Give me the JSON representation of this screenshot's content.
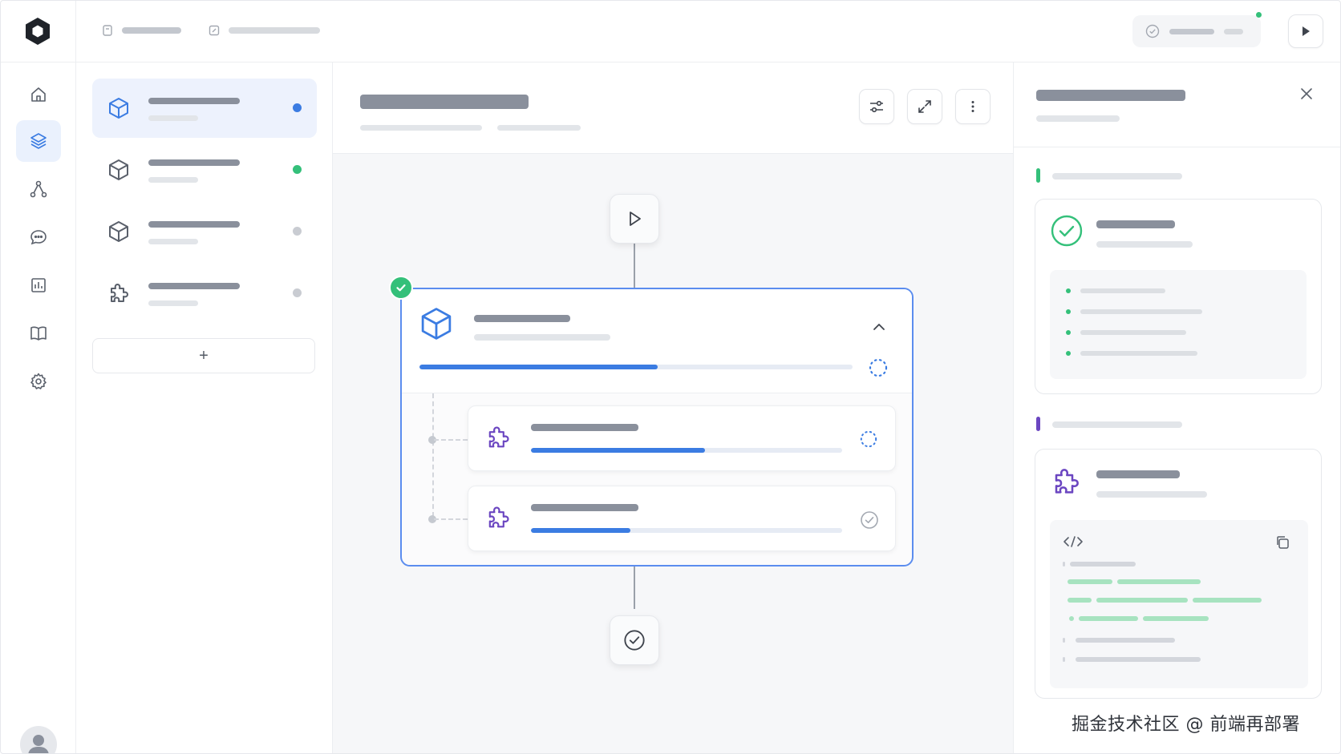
{
  "colors": {
    "accent": "#3b7ce2",
    "success": "#34c07a",
    "purple": "#6b46c1",
    "neutral_dot": "#c9ccd2"
  },
  "topbar": {
    "logo_icon": "hexagon-logo-icon",
    "breadcrumbs": [
      {
        "icon": "lock-icon"
      },
      {
        "icon": "edit-icon"
      }
    ],
    "status_icon": "check-circle-icon",
    "run_icon": "play-icon"
  },
  "rail": {
    "items": [
      {
        "icon": "home-icon",
        "active": false
      },
      {
        "icon": "layers-icon",
        "active": true
      },
      {
        "icon": "graph-icon",
        "active": false
      },
      {
        "icon": "chat-icon",
        "active": false
      },
      {
        "icon": "bar-chart-icon",
        "active": false
      },
      {
        "icon": "book-icon",
        "active": false
      },
      {
        "icon": "gear-icon",
        "active": false
      }
    ],
    "avatar_icon": "user-icon"
  },
  "list": {
    "items": [
      {
        "icon": "cube-icon",
        "status": "blue",
        "active": true
      },
      {
        "icon": "cube-icon",
        "status": "green",
        "active": false
      },
      {
        "icon": "cube-icon",
        "status": "gray",
        "active": false
      },
      {
        "icon": "puzzle-icon",
        "status": "gray",
        "active": false
      }
    ],
    "add_label": "+"
  },
  "canvas": {
    "tools": [
      "sliders-icon",
      "expand-icon",
      "more-vertical-icon"
    ],
    "start_icon": "play-icon",
    "end_icon": "check-circle-icon",
    "main_node": {
      "icon": "cube-icon",
      "collapse_icon": "chevron-up-icon",
      "progress": 0.55,
      "state": "running",
      "completed_badge": true,
      "children": [
        {
          "icon": "puzzle-icon",
          "progress": 0.56,
          "state": "running"
        },
        {
          "icon": "puzzle-icon",
          "progress": 0.32,
          "state": "done"
        }
      ]
    }
  },
  "right_panel": {
    "close_icon": "close-icon",
    "sections": [
      {
        "accent": "green",
        "card_icon": "check-circle-icon",
        "bullets": 4
      },
      {
        "accent": "purple",
        "card_icon": "puzzle-icon",
        "code_icon": "code-icon",
        "copy_icon": "copy-icon"
      }
    ]
  },
  "watermark": "掘金技术社区 @ 前端再部署"
}
